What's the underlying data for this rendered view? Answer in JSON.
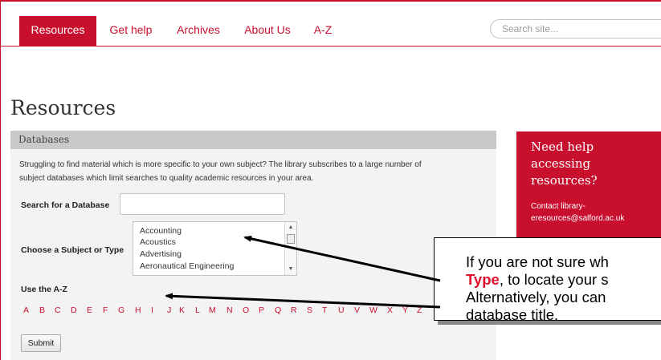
{
  "nav": {
    "items": [
      {
        "label": "Resources",
        "active": true
      },
      {
        "label": "Get help",
        "active": false
      },
      {
        "label": "Archives",
        "active": false
      },
      {
        "label": "About Us",
        "active": false
      },
      {
        "label": "A-Z",
        "active": false
      }
    ],
    "search_placeholder": "Search site..."
  },
  "page": {
    "title": "Resources"
  },
  "databases": {
    "header": "Databases",
    "intro_line1": "Struggling to find material which is more specific to your own subject? The library subscribes to a large number of",
    "intro_line2": "subject databases which limit searches to quality academic resources in your area.",
    "search_label": "Search for a Database",
    "subject_label": "Choose a Subject or Type",
    "subjects": [
      "Accounting",
      "Acoustics",
      "Advertising",
      "Aeronautical Engineering"
    ],
    "az_label": "Use the A-Z",
    "letters": [
      "A",
      "B",
      "C",
      "D",
      "E",
      "F",
      "G",
      "H",
      "I",
      "J",
      "K",
      "L",
      "M",
      "N",
      "O",
      "P",
      "Q",
      "R",
      "S",
      "T",
      "U",
      "V",
      "W",
      "X",
      "Y",
      "Z"
    ],
    "submit_label": "Submit"
  },
  "help": {
    "title": "Need help accessing resources?",
    "contact": "Contact library-eresources@salford.ac.uk"
  },
  "callout": {
    "line1": "If you are not sure wh",
    "line2_highlight": "Type",
    "line2_rest": ", to locate your s",
    "line3": "Alternatively, you can",
    "line4": "database title."
  },
  "colors": {
    "brand": "#c8102e",
    "panel": "#f3f3f3",
    "panel_header": "#c9c9c9"
  }
}
